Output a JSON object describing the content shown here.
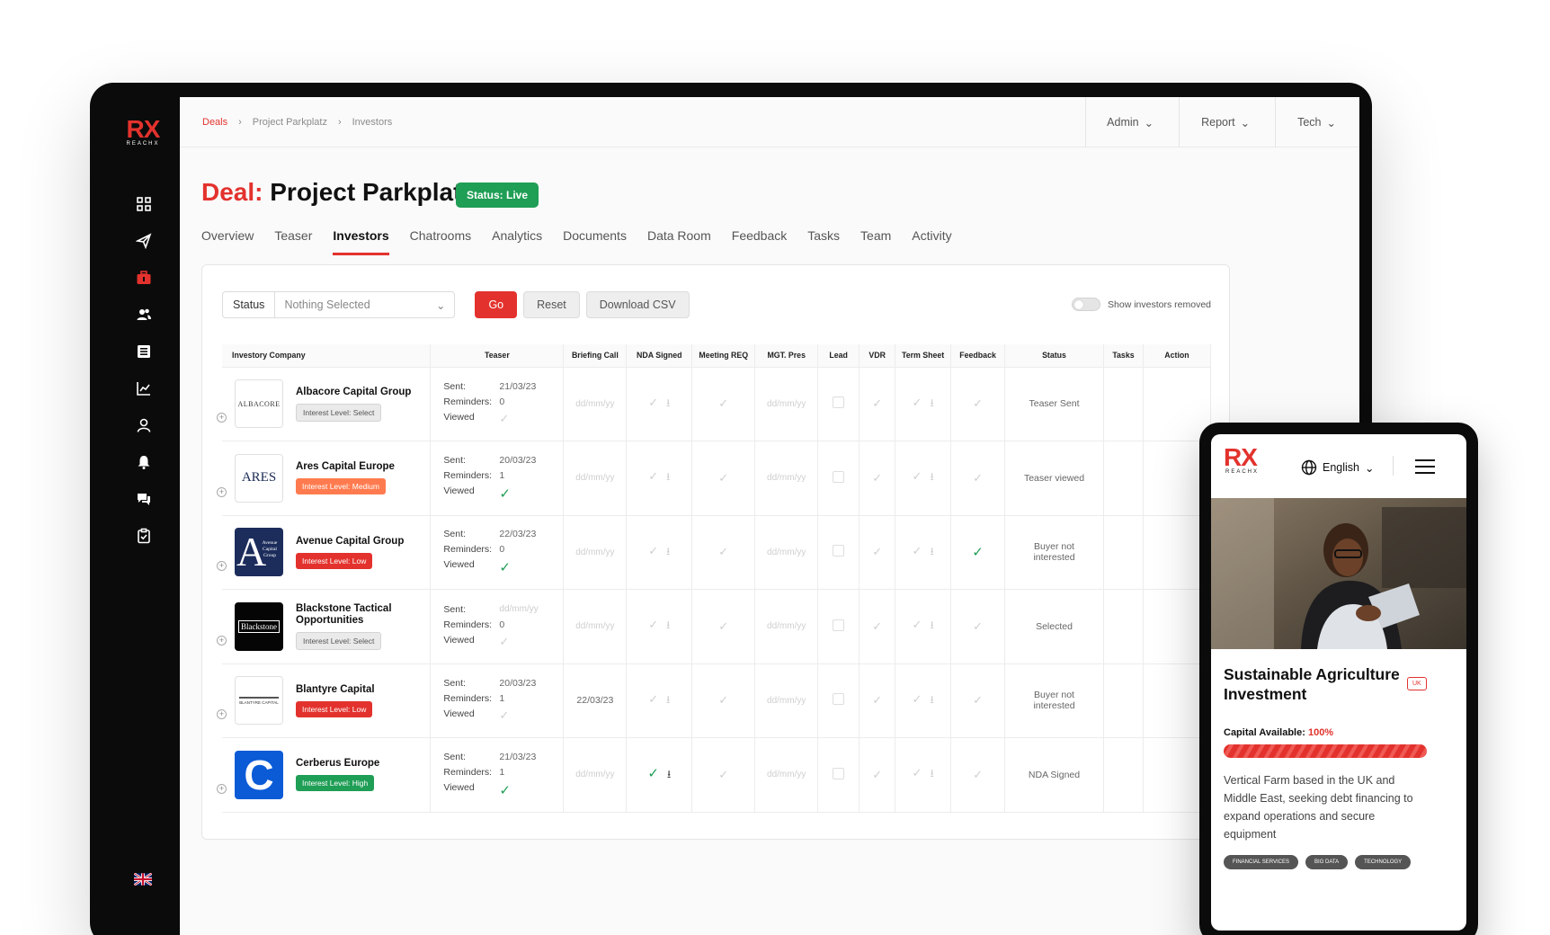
{
  "brand": {
    "name": "RX",
    "sub": "REACHX",
    "accent": "#e3322d",
    "green": "#1f9e55"
  },
  "breadcrumb": [
    "Deals",
    "Project Parkplatz",
    "Investors"
  ],
  "top_menu": [
    "Admin",
    "Report",
    "Tech"
  ],
  "sidebar_icons": [
    "dashboard-icon",
    "send-icon",
    "briefcase-icon",
    "users-icon",
    "list-icon",
    "chart-icon",
    "user-icon",
    "bell-icon",
    "chat-icon",
    "clipboard-check-icon"
  ],
  "deal": {
    "prefix": "Deal:",
    "name": "Project Parkplatz",
    "status": "Status: Live"
  },
  "tabs": [
    "Overview",
    "Teaser",
    "Investors",
    "Chatrooms",
    "Analytics",
    "Documents",
    "Data Room",
    "Feedback",
    "Tasks",
    "Team",
    "Activity"
  ],
  "active_tab": "Investors",
  "filter": {
    "label": "Status",
    "placeholder": "Nothing Selected",
    "go": "Go",
    "reset": "Reset",
    "csv": "Download CSV",
    "toggle_label": "Show investors removed"
  },
  "columns": [
    "Investory Company",
    "Teaser",
    "Briefing Call",
    "NDA Signed",
    "Meeting REQ",
    "MGT. Pres",
    "Lead",
    "VDR",
    "Term Sheet",
    "Feedback",
    "Status",
    "Tasks",
    "Action"
  ],
  "teaser_labels": {
    "sent": "Sent:",
    "reminders": "Reminders:",
    "viewed": "Viewed"
  },
  "date_placeholder": "dd/mm/yy",
  "investors": [
    {
      "name": "Albacore Capital Group",
      "logo": "ALBACORE",
      "level": "Interest Level: Select",
      "level_type": "select",
      "sent": "21/03/23",
      "reminders": "0",
      "viewed": false,
      "briefing": "dd/mm/yy",
      "nda": false,
      "feedback": false,
      "status": "Teaser Sent"
    },
    {
      "name": "Ares Capital Europe",
      "logo": "ARES",
      "level": "Interest Level: Medium",
      "level_type": "medium",
      "sent": "20/03/23",
      "reminders": "1",
      "viewed": true,
      "briefing": "dd/mm/yy",
      "nda": false,
      "feedback": false,
      "status": "Teaser viewed"
    },
    {
      "name": "Avenue Capital Group",
      "logo": "Avenue Capital Group",
      "level": "Interest Level: Low",
      "level_type": "low",
      "sent": "22/03/23",
      "reminders": "0",
      "viewed": true,
      "briefing": "dd/mm/yy",
      "nda": false,
      "feedback": true,
      "status": "Buyer not interested"
    },
    {
      "name": "Blackstone Tactical Opportunities",
      "logo": "Blackstone",
      "level": "Interest Level: Select",
      "level_type": "select",
      "sent": "dd/mm/yy",
      "reminders": "0",
      "viewed": false,
      "briefing": "dd/mm/yy",
      "nda": false,
      "feedback": false,
      "status": "Selected"
    },
    {
      "name": "Blantyre Capital",
      "logo": "BLANTYRE CAPITAL",
      "level": "Interest Level: Low",
      "level_type": "low",
      "sent": "20/03/23",
      "reminders": "1",
      "viewed": false,
      "briefing": "22/03/23",
      "nda": false,
      "feedback": false,
      "status": "Buyer not interested"
    },
    {
      "name": "Cerberus Europe",
      "logo": "C",
      "level": "Interest Level: High",
      "level_type": "high",
      "sent": "21/03/23",
      "reminders": "1",
      "viewed": true,
      "briefing": "dd/mm/yy",
      "nda": true,
      "feedback": false,
      "status": "NDA Signed"
    }
  ],
  "phone": {
    "language": "English",
    "title": "Sustainable Agriculture Investment",
    "badge": "UK",
    "capital_label": "Capital Available:",
    "capital_pct": "100%",
    "capital_fill": 1.0,
    "description": "Vertical Farm based in the UK and Middle East, seeking debt financing to expand operations and secure equipment",
    "tags": [
      "FINANCIAL SERVICES",
      "BIG DATA",
      "TECHNOLOGY"
    ]
  }
}
